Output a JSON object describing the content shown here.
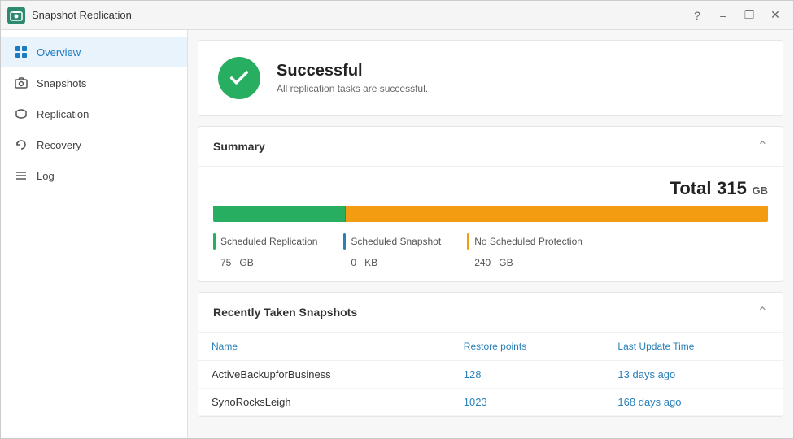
{
  "window": {
    "title": "Snapshot Replication",
    "icon": "📷"
  },
  "titlebar_controls": {
    "help": "?",
    "minimize": "–",
    "maximize": "❐",
    "close": "✕"
  },
  "sidebar": {
    "items": [
      {
        "id": "overview",
        "label": "Overview",
        "icon": "grid",
        "active": true
      },
      {
        "id": "snapshots",
        "label": "Snapshots",
        "icon": "camera"
      },
      {
        "id": "replication",
        "label": "Replication",
        "icon": "replication"
      },
      {
        "id": "recovery",
        "label": "Recovery",
        "icon": "recovery"
      },
      {
        "id": "log",
        "label": "Log",
        "icon": "log"
      }
    ]
  },
  "status": {
    "title": "Successful",
    "description": "All replication tasks are successful."
  },
  "summary": {
    "section_title": "Summary",
    "total_label": "Total",
    "total_value": "315",
    "total_unit": "GB",
    "scheduled_replication": {
      "label": "Scheduled Replication",
      "value": "75",
      "unit": "GB",
      "color": "#27ae60"
    },
    "scheduled_snapshot": {
      "label": "Scheduled Snapshot",
      "value": "0",
      "unit": "KB",
      "color": "#2980b9"
    },
    "no_scheduled": {
      "label": "No Scheduled Protection",
      "value": "240",
      "unit": "GB",
      "color": "#f39c12"
    },
    "bar_green_pct": 23.8,
    "bar_yellow_pct": 76.2
  },
  "snapshots_section": {
    "section_title": "Recently Taken Snapshots",
    "columns": [
      "Name",
      "Restore points",
      "Last Update Time"
    ],
    "rows": [
      {
        "name": "ActiveBackupforBusiness",
        "restore_points": "128",
        "last_update": "13 days ago"
      },
      {
        "name": "SynoRocksLeigh",
        "restore_points": "1023",
        "last_update": "168 days ago"
      }
    ]
  }
}
